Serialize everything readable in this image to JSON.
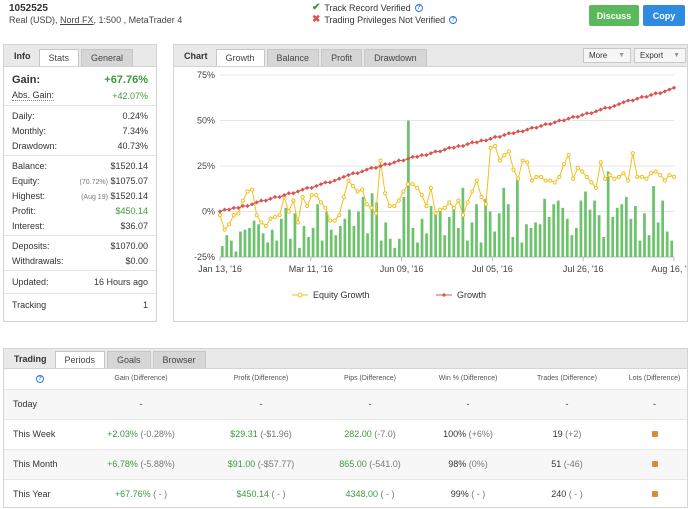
{
  "header": {
    "account_id": "1052525",
    "account_type": "Real (USD),",
    "broker": "Nord FX",
    "leverage": ", 1:500 , MetaTrader 4",
    "track_record": "Track Record Verified",
    "trading_privileges": "Trading Privileges Not Verified",
    "discuss_label": "Discuss",
    "copy_label": "Copy"
  },
  "colors": {
    "green": "#5cb85c",
    "blue": "#2f8be0",
    "growth": "#d9534f",
    "equity": "#f0c020",
    "bars": "#6cc36c"
  },
  "info": {
    "title": "Info",
    "tabs": [
      "Stats",
      "General"
    ],
    "gain_label": "Gain:",
    "gain_value": "+67.76%",
    "abs_gain_label": "Abs. Gain:",
    "abs_gain_value": "+42.07%",
    "daily_label": "Daily:",
    "daily_value": "0.24%",
    "monthly_label": "Monthly:",
    "monthly_value": "7.34%",
    "drawdown_label": "Drawdown:",
    "drawdown_value": "40.73%",
    "balance_label": "Balance:",
    "balance_value": "$1520.14",
    "equity_label": "Equity:",
    "equity_note": "(70.72%)",
    "equity_value": "$1075.07",
    "highest_label": "Highest:",
    "highest_note": "(Aug 19)",
    "highest_value": "$1520.14",
    "profit_label": "Profit:",
    "profit_value": "$450.14",
    "interest_label": "Interest:",
    "interest_value": "$36.07",
    "deposits_label": "Deposits:",
    "deposits_value": "$1070.00",
    "withdrawals_label": "Withdrawals:",
    "withdrawals_value": "$0.00",
    "updated_label": "Updated:",
    "updated_value": "16 Hours ago",
    "tracking_label": "Tracking",
    "tracking_value": "1"
  },
  "chart_panel": {
    "title": "Chart",
    "tabs": [
      "Growth",
      "Balance",
      "Profit",
      "Drawdown"
    ],
    "more_label": "More",
    "export_label": "Export"
  },
  "chart_data": {
    "type": "line",
    "y_ticks": [
      "75%",
      "50%",
      "25%",
      "0%",
      "-25%"
    ],
    "ylim": [
      -25,
      75
    ],
    "x_ticks": [
      "Jan 13, '16",
      "Mar 11, '16",
      "Jun 09, '16",
      "Jul 05, '16",
      "Jul 26, '16",
      "Aug 16, '16"
    ],
    "legend_position": "bottom",
    "series": [
      {
        "name": "Equity Growth",
        "values": [
          -2,
          -10,
          -7,
          -2,
          -1,
          6,
          11,
          12,
          -2,
          -6,
          -8,
          -4,
          -3,
          -2,
          8,
          0,
          6,
          -6,
          8,
          3,
          9,
          9,
          5,
          2,
          -5,
          -5,
          -2,
          8,
          17,
          14,
          11,
          12,
          4,
          2,
          -1,
          28,
          10,
          3,
          3,
          6,
          11,
          15,
          15,
          13,
          9,
          3,
          13,
          -1,
          1,
          2,
          5,
          2,
          6,
          -2,
          5,
          11,
          17,
          8,
          4,
          35,
          36,
          28,
          31,
          33,
          23,
          18,
          28,
          27,
          17,
          19,
          19,
          17,
          17,
          16,
          19,
          26,
          31,
          18,
          24,
          22,
          19,
          16,
          13,
          27,
          18,
          20,
          18,
          19,
          21,
          17,
          32,
          19,
          19,
          18,
          21,
          22,
          20,
          17,
          20,
          19
        ]
      },
      {
        "name": "Growth",
        "values": [
          0,
          1,
          1,
          2,
          2,
          3,
          3,
          4,
          5,
          6,
          6,
          7,
          8,
          8,
          9,
          10,
          10,
          11,
          12,
          13,
          13,
          14,
          15,
          16,
          16,
          17,
          18,
          19,
          20,
          21,
          21,
          22,
          23,
          24,
          24,
          25,
          26,
          26,
          27,
          28,
          28,
          29,
          30,
          30,
          31,
          31,
          32,
          33,
          33,
          34,
          35,
          35,
          36,
          36,
          37,
          38,
          38,
          39,
          39,
          40,
          41,
          41,
          42,
          43,
          43,
          44,
          44,
          45,
          46,
          46,
          47,
          48,
          48,
          49,
          50,
          50,
          51,
          52,
          52,
          53,
          54,
          54,
          55,
          56,
          57,
          57,
          58,
          59,
          60,
          61,
          61,
          62,
          63,
          63,
          64,
          65,
          65,
          66,
          67,
          68
        ]
      }
    ],
    "bars": [
      6,
      12,
      9,
      3,
      14,
      15,
      16,
      20,
      18,
      13,
      8,
      15,
      9,
      21,
      27,
      10,
      24,
      5,
      17,
      11,
      16,
      29,
      9,
      25,
      15,
      12,
      17,
      21,
      26,
      17,
      25,
      33,
      13,
      35,
      30,
      9,
      19,
      10,
      5,
      10,
      33,
      75,
      16,
      8,
      21,
      13,
      28,
      24,
      25,
      12,
      22,
      27,
      16,
      38,
      9,
      19,
      29,
      8,
      32,
      25,
      14,
      24,
      38,
      29,
      11,
      43,
      8,
      18,
      16,
      19,
      18,
      32,
      22,
      29,
      31,
      27,
      21,
      12,
      16,
      31,
      36,
      26,
      31,
      23,
      11,
      47,
      22,
      27,
      29,
      33,
      21,
      28,
      9,
      24,
      12,
      39,
      19,
      31,
      14,
      9
    ]
  },
  "trading": {
    "title": "Trading",
    "tabs": [
      "Periods",
      "Goals",
      "Browser"
    ],
    "columns": [
      "",
      "Gain (Difference)",
      "Profit (Difference)",
      "Pips (Difference)",
      "Win % (Difference)",
      "Trades (Difference)",
      "Lots (Difference)"
    ],
    "rows": [
      {
        "label": "Today",
        "gain": "-",
        "gain_diff": "",
        "profit": "-",
        "profit_diff": "",
        "pips": "-",
        "pips_diff": "",
        "win": "-",
        "win_diff": "",
        "trades": "-",
        "trades_diff": ""
      },
      {
        "label": "This Week",
        "gain": "+2.03%",
        "gain_diff": "(-0.28%)",
        "profit": "$29.31",
        "profit_diff": "(-$1.96)",
        "pips": "282.00",
        "pips_diff": "(-7.0)",
        "win": "100%",
        "win_diff": "(+6%)",
        "trades": "19",
        "trades_diff": "(+2)"
      },
      {
        "label": "This Month",
        "gain": "+6.78%",
        "gain_diff": "(-5.88%)",
        "profit": "$91.00",
        "profit_diff": "(-$57.77)",
        "pips": "865.00",
        "pips_diff": "(-541.0)",
        "win": "98%",
        "win_diff": "(0%)",
        "trades": "51",
        "trades_diff": "(-46)"
      },
      {
        "label": "This Year",
        "gain": "+67.76%",
        "gain_diff": "( - )",
        "profit": "$450.14",
        "profit_diff": "( - )",
        "pips": "4348.00",
        "pips_diff": "( - )",
        "win": "99%",
        "win_diff": "( - )",
        "trades": "240",
        "trades_diff": "( - )"
      }
    ]
  }
}
